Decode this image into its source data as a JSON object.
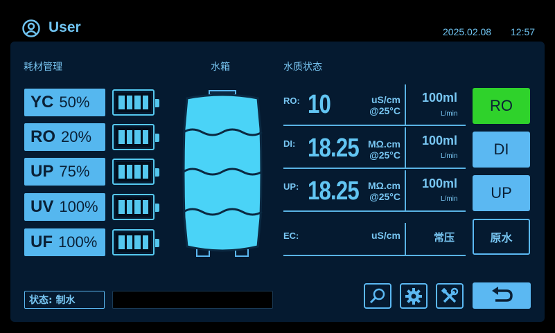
{
  "header": {
    "user_label": "User",
    "date": "2025.02.08",
    "time": "12:57"
  },
  "consumables": {
    "title": "耗材管理",
    "items": [
      {
        "name": "YC",
        "percent": "50%",
        "level": 1.0
      },
      {
        "name": "RO",
        "percent": "20%",
        "level": 1.0
      },
      {
        "name": "UP",
        "percent": "75%",
        "level": 1.0
      },
      {
        "name": "UV",
        "percent": "100%",
        "level": 1.0
      },
      {
        "name": "UF",
        "percent": "100%",
        "level": 1.0
      }
    ]
  },
  "tank": {
    "title": "水箱",
    "level": 1.0
  },
  "quality": {
    "title": "水质状态",
    "rows": [
      {
        "label": "RO:",
        "value": "10",
        "unit": "uS/cm",
        "temp": "@25°C",
        "flow": "100ml",
        "flow_unit": "L/min"
      },
      {
        "label": "DI:",
        "value": "18.25",
        "unit": "MΩ.cm",
        "temp": "@25°C",
        "flow": "100ml",
        "flow_unit": "L/min"
      },
      {
        "label": "UP:",
        "value": "18.25",
        "unit": "MΩ.cm",
        "temp": "@25°C",
        "flow": "100ml",
        "flow_unit": "L/min"
      },
      {
        "label": "EC:",
        "value": "",
        "unit": "uS/cm",
        "temp": "",
        "flow": "常压",
        "flow_unit": ""
      }
    ]
  },
  "modes": [
    {
      "label": "RO",
      "active": true
    },
    {
      "label": "DI",
      "active": false
    },
    {
      "label": "UP",
      "active": false
    },
    {
      "label": "原水",
      "active": false
    }
  ],
  "status": {
    "label": "状态: 制水",
    "message": ""
  },
  "toolbar": {
    "icons": [
      "search-icon",
      "gear-icon",
      "tools-icon",
      "back-icon"
    ]
  },
  "colors": {
    "accent": "#5bb8f2",
    "active": "#2fd22b",
    "panel": "#051a30"
  }
}
